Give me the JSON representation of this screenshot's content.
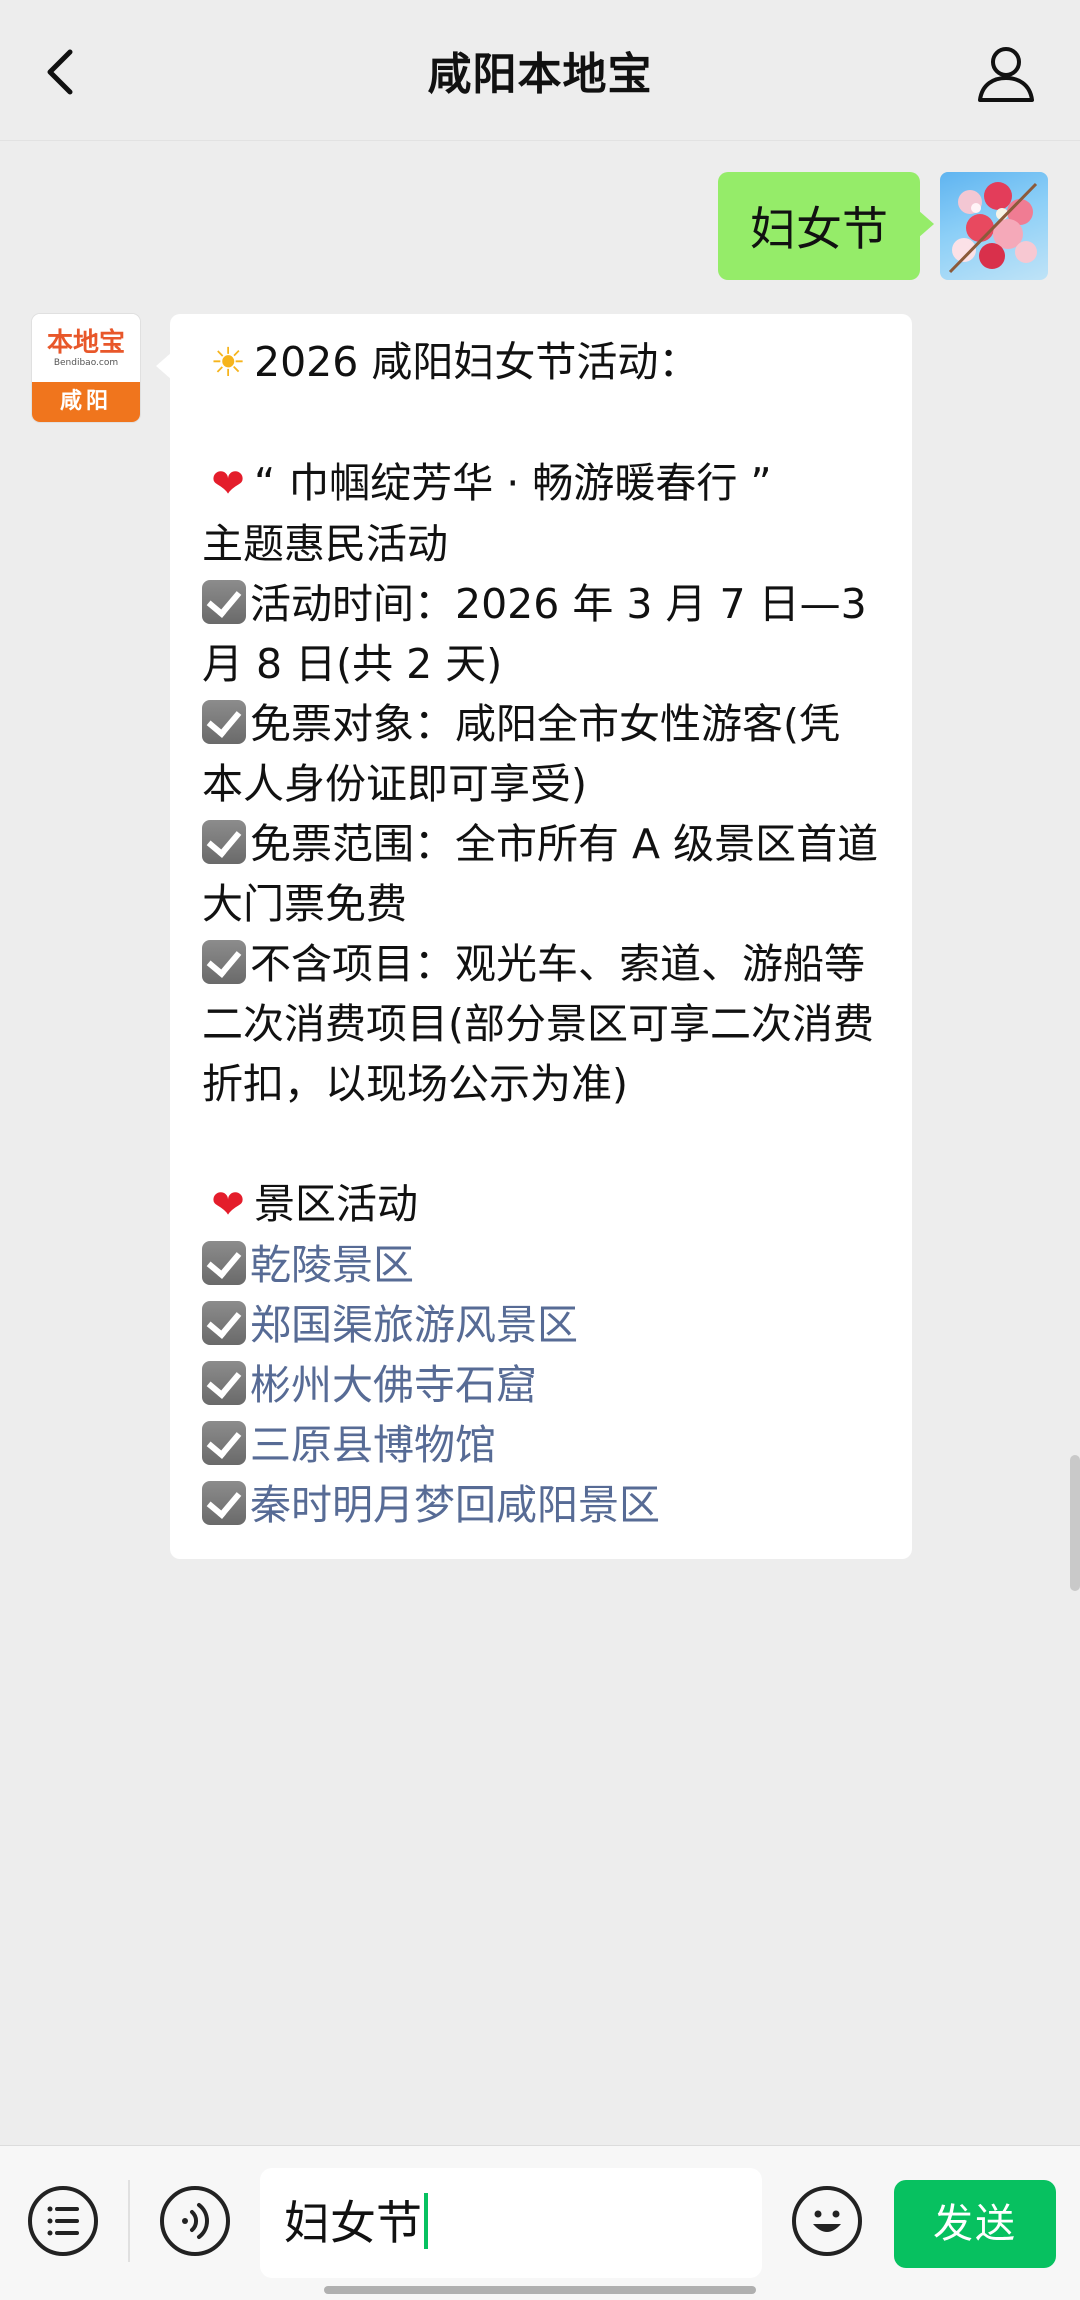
{
  "header": {
    "title": "咸阳本地宝"
  },
  "outgoing": {
    "text": "妇女节"
  },
  "bot_avatar": {
    "logo": "本地宝",
    "site": "Bendibao.com",
    "city": "咸阳"
  },
  "message": {
    "title": "2026 咸阳妇女节活动：",
    "theme_line1": "“ 巾帼绽芳华 · 畅游暖春行 ”",
    "theme_line2": "主题惠民活动",
    "time": "活动时间：2026 年 3 月 7 日—3月 8 日(共 2 天)",
    "target": "免票对象：咸阳全市女性游客(凭本人身份证即可享受)",
    "scope": "免票范围：全市所有 A 级景区首道大门票免费",
    "exclude": "不含项目：观光车、索道、游船等二次消费项目(部分景区可享二次消费折扣，以现场公示为准)",
    "section": "景区活动",
    "links": [
      "乾陵景区",
      "郑国渠旅游风景区",
      "彬州大佛寺石窟",
      "三原县博物馆",
      "秦时明月梦回咸阳景区"
    ]
  },
  "input": {
    "value": "妇女节"
  },
  "send_label": "发送",
  "icons": {
    "sun": "☀",
    "heart": "❤"
  },
  "colors": {
    "bubble_out": "#95ec69",
    "send": "#07c160",
    "link": "#576b95"
  }
}
